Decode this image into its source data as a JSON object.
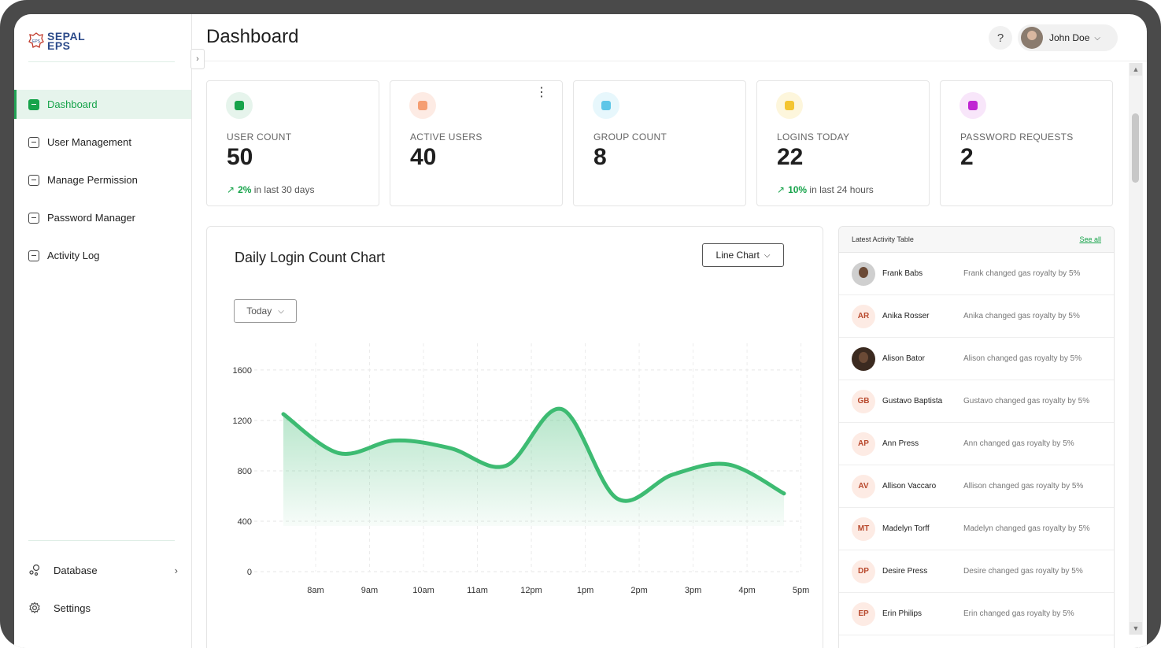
{
  "brand": {
    "logo_text_top": "SEPAL",
    "logo_text_bottom": "EPS"
  },
  "sidebar": {
    "items": [
      {
        "label": "Dashboard",
        "icon": "dashboard-icon",
        "active": true
      },
      {
        "label": "User Management",
        "icon": "user-icon",
        "active": false
      },
      {
        "label": "Manage Permission",
        "icon": "id-card-icon",
        "active": false
      },
      {
        "label": "Password Manager",
        "icon": "key-icon",
        "active": false
      },
      {
        "label": "Activity Log",
        "icon": "log-icon",
        "active": false
      }
    ],
    "bottom": [
      {
        "label": "Database",
        "icon": "database-icon"
      },
      {
        "label": "Settings",
        "icon": "gear-icon"
      }
    ]
  },
  "header": {
    "title": "Dashboard",
    "help": "?",
    "user_name": "John Doe"
  },
  "stats": [
    {
      "label": "USER COUNT",
      "value": "50",
      "trend_pct": "2%",
      "trend_text": " in last 30 days",
      "icon_color": "#16a34a",
      "icon_bg": "#e6f4ec"
    },
    {
      "label": "ACTIVE USERS",
      "value": "40",
      "trend_pct": "",
      "trend_text": "",
      "icon_color": "#f59e72",
      "icon_bg": "#fdebe4"
    },
    {
      "label": "GROUP COUNT",
      "value": "8",
      "trend_pct": "",
      "trend_text": "",
      "icon_color": "#5ec6e8",
      "icon_bg": "#e7f7fc"
    },
    {
      "label": "LOGINS TODAY",
      "value": "22",
      "trend_pct": "10%",
      "trend_text": " in last 24 hours",
      "icon_color": "#f4c531",
      "icon_bg": "#fdf6dc"
    },
    {
      "label": "PASSWORD REQUESTS",
      "value": "2",
      "trend_pct": "",
      "trend_text": "",
      "icon_color": "#c026d3",
      "icon_bg": "#f8e6fa"
    }
  ],
  "chart": {
    "title": "Daily Login Count Chart",
    "type_select": "Line Chart",
    "range_select": "Today"
  },
  "chart_data": {
    "type": "area",
    "title": "Daily Login Count Chart",
    "xlabel": "",
    "ylabel": "",
    "categories": [
      "8am",
      "9am",
      "10am",
      "11am",
      "12pm",
      "1pm",
      "2pm",
      "3pm",
      "4pm",
      "5pm"
    ],
    "y_ticks": [
      0,
      400,
      800,
      1200,
      1600
    ],
    "ylim": [
      0,
      1600
    ],
    "series": [
      {
        "values": [
          1250,
          940,
          1040,
          980,
          840,
          1290,
          580,
          770,
          850,
          620
        ]
      }
    ],
    "grid": true,
    "color": "#3dbb72"
  },
  "activity": {
    "title": "Latest Activity Table",
    "see_all": "See all",
    "rows": [
      {
        "initials": "",
        "name": "Frank Babs",
        "desc": "Frank changed gas royalty by 5%",
        "photo": true
      },
      {
        "initials": "AR",
        "name": "Anika Rosser",
        "desc": "Anika changed gas royalty by 5%"
      },
      {
        "initials": "",
        "name": "Alison Bator",
        "desc": "Alison changed gas royalty by 5%",
        "photo": true
      },
      {
        "initials": "GB",
        "name": "Gustavo Baptista",
        "desc": "Gustavo changed gas royalty by 5%"
      },
      {
        "initials": "AP",
        "name": "Ann Press",
        "desc": "Ann changed gas royalty by 5%"
      },
      {
        "initials": "AV",
        "name": "Allison Vaccaro",
        "desc": "Allison changed gas royalty by 5%"
      },
      {
        "initials": "MT",
        "name": "Madelyn Torff",
        "desc": "Madelyn changed gas royalty by 5%"
      },
      {
        "initials": "DP",
        "name": "Desire Press",
        "desc": "Desire changed gas royalty by 5%"
      },
      {
        "initials": "EP",
        "name": "Erin Philips",
        "desc": "Erin changed gas royalty by 5%"
      }
    ]
  }
}
